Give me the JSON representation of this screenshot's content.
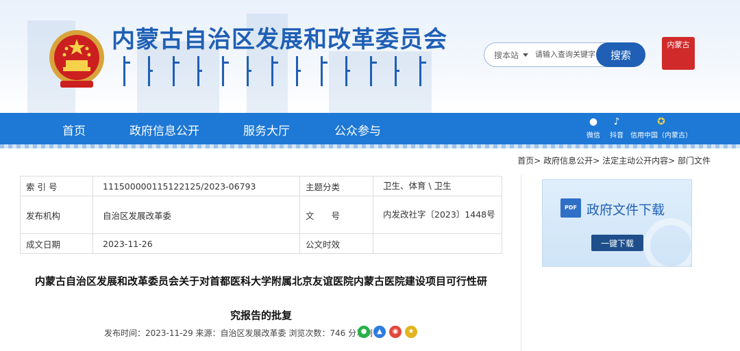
{
  "header": {
    "site_title": "内蒙古自治区发展和改革委员会",
    "search": {
      "scope": "搜本站",
      "placeholder": "请输入查询关键字",
      "button": "搜索"
    },
    "seal_text": "内蒙古"
  },
  "nav": {
    "items": [
      "首页",
      "政府信息公开",
      "服务大厅",
      "公众参与"
    ],
    "social": [
      {
        "label": "微信",
        "icon": "wechat-icon"
      },
      {
        "label": "抖音",
        "icon": "douyin-icon"
      },
      {
        "label": "信用中国（内蒙古）",
        "icon": "emblem-icon"
      }
    ]
  },
  "breadcrumb": {
    "items": [
      "首页",
      "政府信息公开",
      "法定主动公开内容",
      "部门文件"
    ],
    "separator": ">"
  },
  "info": {
    "index_label": "索 引 号",
    "index_value": "111500000115122125/2023-06793",
    "topic_label": "主题分类",
    "topic_value": "卫生、体育 \\ 卫生",
    "issuer_label": "发布机构",
    "issuer_value": "自治区发展改革委",
    "doc_no_label": "文　　号",
    "doc_no_value": "内发改社字〔2023〕1448号",
    "date_label": "成文日期",
    "date_value": "2023-11-26",
    "effective_label": "公文时效",
    "effective_value": ""
  },
  "document": {
    "title_line1": "内蒙古自治区发展和改革委员会关于对首都医科大学附属北京友谊医院内蒙古医院建设项目可行性研",
    "title_line2": "究报告的批复",
    "meta": "发布时间：2023-11-29  来源：自治区发展改革委  浏览次数：746  分享到"
  },
  "sidebar": {
    "download_title": "政府文件下载",
    "download_button": "一键下载",
    "pdf_label": "PDF"
  },
  "colors": {
    "brand_blue": "#1f5fb5",
    "nav_blue": "#1d78d6",
    "seal_red": "#d12a2a",
    "button_dark": "#1e4f8a"
  }
}
